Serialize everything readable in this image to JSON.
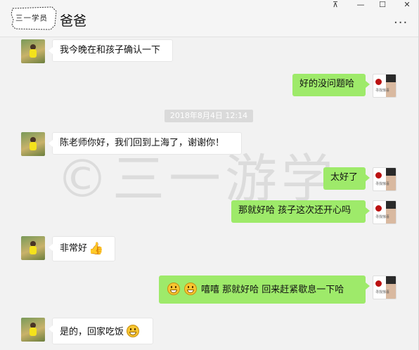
{
  "header": {
    "badge_text": "三一学员",
    "contact_name": "爸爸",
    "more_label": "···",
    "controls": {
      "pin": "⊼",
      "minimize": "—",
      "maximize": "☐",
      "close": "✕"
    }
  },
  "watermark": "©三一游学",
  "timestamp": "2018年8月4日 12:14",
  "messages": [
    {
      "side": "left",
      "text": "我今晚在和孩子确认一下"
    },
    {
      "side": "right",
      "text": "好的没问题哈"
    },
    {
      "side": "left",
      "text": "陈老师你好，我们回到上海了，谢谢你！"
    },
    {
      "side": "right",
      "text": "太好了"
    },
    {
      "side": "right",
      "text": "那就好哈 孩子这次还开心吗"
    },
    {
      "side": "left",
      "text": "非常好",
      "emoji": "thumbs-up"
    },
    {
      "side": "right",
      "text": "嘻嘻 那就好哈 回来赶紧歇息一下哈",
      "emoji": "grin-x2"
    },
    {
      "side": "left",
      "text": "是的，回家吃饭",
      "emoji": "grin"
    }
  ],
  "colors": {
    "sent_bubble": "#9eea6a",
    "received_bubble": "#ffffff",
    "background": "#f2f2f2"
  }
}
